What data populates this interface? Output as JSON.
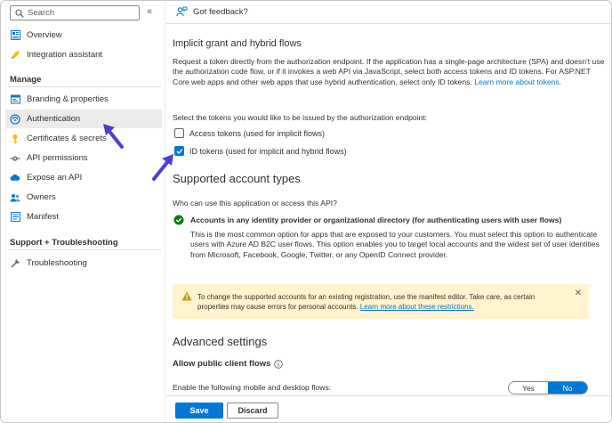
{
  "sidebar": {
    "search_placeholder": "Search",
    "collapse_glyph": "«",
    "items_top": [
      {
        "label": "Overview",
        "icon": "overview-icon"
      },
      {
        "label": "Integration assistant",
        "icon": "rocket-icon"
      }
    ],
    "manage_heading": "Manage",
    "manage_items": [
      {
        "label": "Branding & properties",
        "icon": "branding-icon"
      },
      {
        "label": "Authentication",
        "icon": "authentication-icon",
        "active": true
      },
      {
        "label": "Certificates & secrets",
        "icon": "key-icon"
      },
      {
        "label": "API permissions",
        "icon": "api-permissions-icon"
      },
      {
        "label": "Expose an API",
        "icon": "cloud-icon"
      },
      {
        "label": "Owners",
        "icon": "owners-icon"
      },
      {
        "label": "Manifest",
        "icon": "manifest-icon"
      }
    ],
    "support_heading": "Support + Troubleshooting",
    "support_items": [
      {
        "label": "Troubleshooting",
        "icon": "wrench-icon"
      }
    ]
  },
  "header": {
    "feedback_label": "Got feedback?"
  },
  "implicit": {
    "title": "Implicit grant and hybrid flows",
    "description": "Request a token directly from the authorization endpoint. If the application has a single-page architecture (SPA) and doesn't use the authorization code flow, or if it invokes a web API via JavaScript, select both access tokens and ID tokens. For ASP.NET Core web apps and other web apps that use hybrid authentication, select only ID tokens.",
    "learn_more": "Learn more about tokens.",
    "select_prompt": "Select the tokens you would like to be issued by the authorization endpoint:",
    "access_tokens_label": "Access tokens (used for implicit flows)",
    "access_tokens_checked": false,
    "id_tokens_label": "ID tokens (used for implicit and hybrid flows)",
    "id_tokens_checked": true
  },
  "account_types": {
    "title": "Supported account types",
    "question": "Who can use this application or access this API?",
    "option_title": "Accounts in any identity provider or organizational directory (for authenticating users with user flows)",
    "option_description": "This is the most common option for apps that are exposed to your customers. You must select this option to authenticate users with Azure AD B2C user flows. This option enables you to target local accounts and the widest set of user identities from Microsoft, Facebook, Google, Twitter, or any OpenID Connect provider."
  },
  "warning": {
    "text": "To change the supported accounts for an existing registration, use the manifest editor. Take care, as certain properties may cause errors for personal accounts.",
    "link": "Learn more about these restrictions."
  },
  "advanced": {
    "title": "Advanced settings",
    "public_client_label": "Allow public client flows",
    "flows_label": "Enable the following mobile and desktop flows:",
    "toggle_yes": "Yes",
    "toggle_no": "No",
    "toggle_selected": "No"
  },
  "footer": {
    "save_label": "Save",
    "discard_label": "Discard"
  },
  "colors": {
    "accent": "#0078d4",
    "arrow": "#4b3fd1",
    "success": "#107c10",
    "warning_bg": "#fff4ce",
    "warning_icon": "#c19c00"
  }
}
